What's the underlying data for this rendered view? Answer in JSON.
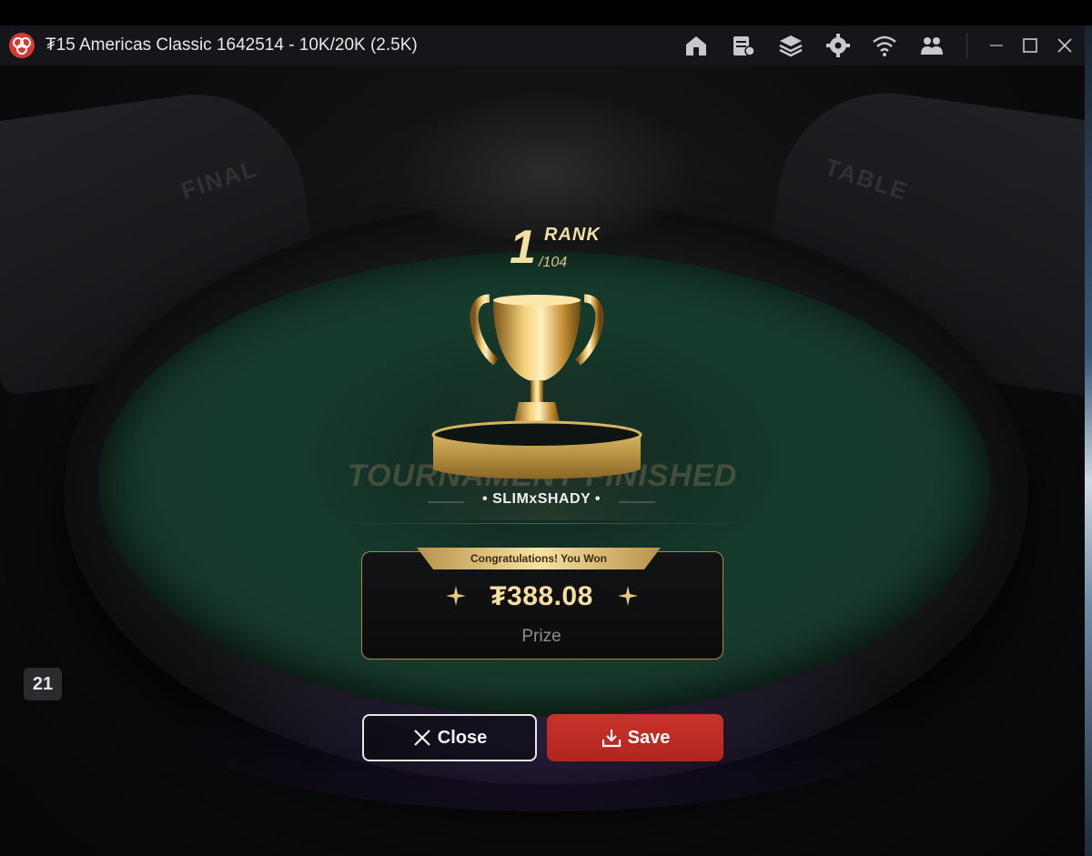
{
  "window": {
    "title": "₮15 Americas Classic 1642514 - 10K/20K (2.5K)",
    "toolbar_icons": [
      "home-icon",
      "lobby-icon",
      "layers-icon",
      "settings-icon",
      "wifi-icon",
      "players-icon"
    ],
    "controls": [
      "minimize-icon",
      "maximize-icon",
      "close-icon"
    ]
  },
  "scene": {
    "chair_labels": [
      "FINAL",
      "TABLE"
    ]
  },
  "result": {
    "rank": "1",
    "rank_word": "RANK",
    "rank_total": "/104",
    "background_text": "TOURNAMENT FINISHED",
    "player_name": "SLIMxSHADY",
    "banner": "Congratulations! You Won",
    "prize_amount": "₮388.08",
    "prize_label": "Prize"
  },
  "buttons": {
    "close_label": "Close",
    "save_label": "Save"
  },
  "side_badge": "21",
  "colors": {
    "gold": "#f3dfa4",
    "save_red": "#c9322a",
    "felt_green": "#163b2d",
    "titlebar": "#151619"
  }
}
